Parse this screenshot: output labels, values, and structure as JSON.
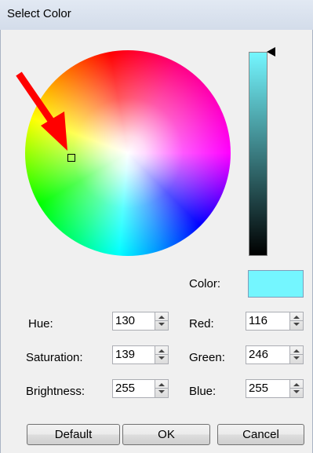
{
  "window": {
    "title": "Select Color"
  },
  "picker": {
    "color_label": "Color:",
    "selected_color": "#74f6ff"
  },
  "fields": {
    "hue": {
      "label": "Hue:",
      "value": "130"
    },
    "saturation": {
      "label": "Saturation:",
      "value": "139"
    },
    "brightness": {
      "label": "Brightness:",
      "value": "255"
    },
    "red": {
      "label": "Red:",
      "value": "116"
    },
    "green": {
      "label": "Green:",
      "value": "246"
    },
    "blue": {
      "label": "Blue:",
      "value": "255"
    }
  },
  "buttons": {
    "default": "Default",
    "ok": "OK",
    "cancel": "Cancel"
  },
  "icons": {
    "spin_up": "chevron-up-icon",
    "spin_down": "chevron-down-icon",
    "annotation": "red-arrow-icon",
    "brightness_pointer": "triangle-pointer-icon"
  }
}
